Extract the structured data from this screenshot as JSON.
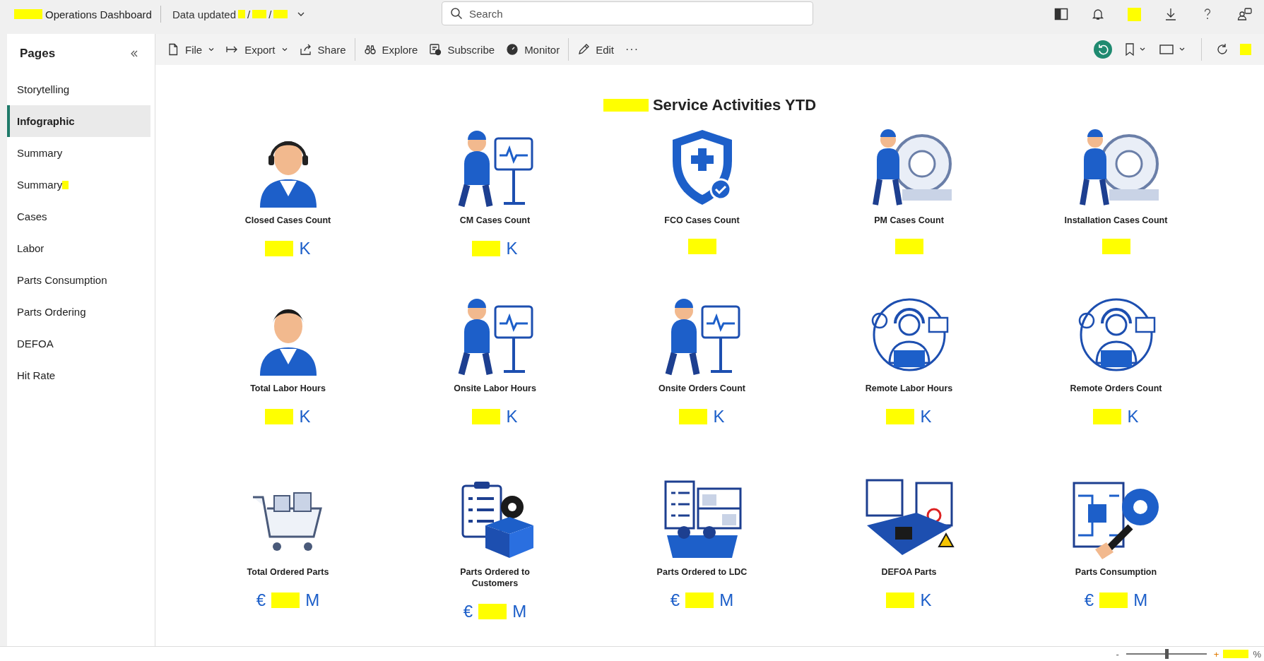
{
  "app_bar": {
    "title": "Operations Dashboard",
    "title_redacted": true,
    "data_updated": "Data updated",
    "date_separators": [
      "/",
      "/"
    ],
    "search": {
      "placeholder": "Search"
    }
  },
  "toolbar": {
    "buttons": [
      {
        "label": "File",
        "has_menu": true,
        "separator_after": false
      },
      {
        "label": "Export",
        "has_menu": true,
        "separator_after": false
      },
      {
        "label": "Share",
        "has_menu": false,
        "separator_after": true
      },
      {
        "label": "Explore",
        "has_menu": false,
        "separator_after": false
      },
      {
        "label": "Subscribe",
        "has_menu": false,
        "separator_after": false
      },
      {
        "label": "Monitor",
        "has_menu": false,
        "separator_after": true
      },
      {
        "label": "Edit",
        "has_menu": false,
        "separator_after": false
      }
    ],
    "more": "···"
  },
  "sidebar": {
    "title": "Pages",
    "items": [
      {
        "label": "Storytelling",
        "selected": false,
        "redacted": false
      },
      {
        "label": "Infographic",
        "selected": true,
        "redacted": false
      },
      {
        "label": "Summary",
        "selected": false,
        "redacted": false
      },
      {
        "label": "Summary",
        "selected": false,
        "redacted": true
      },
      {
        "label": "Cases",
        "selected": false,
        "redacted": false
      },
      {
        "label": "Labor",
        "selected": false,
        "redacted": false
      },
      {
        "label": "Parts Consumption",
        "selected": false,
        "redacted": false
      },
      {
        "label": "Parts Ordering",
        "selected": false,
        "redacted": false
      },
      {
        "label": "DEFOA",
        "selected": false,
        "redacted": false
      },
      {
        "label": "Hit Rate",
        "selected": false,
        "redacted": false
      }
    ]
  },
  "report": {
    "title": "Service Activities YTD",
    "title_redacted": true,
    "cards": [
      {
        "label": "Closed Cases Count",
        "redacted": true,
        "suffix": "K"
      },
      {
        "label": "CM Cases Count",
        "redacted": true,
        "suffix": "K"
      },
      {
        "label": "FCO Cases Count",
        "redacted": true
      },
      {
        "label": "PM Cases Count",
        "redacted": true
      },
      {
        "label": "Installation Cases Count",
        "redacted": true
      },
      {
        "label": "Total Labor Hours",
        "redacted": true,
        "suffix": "K"
      },
      {
        "label": "Onsite Labor Hours",
        "redacted": true,
        "suffix": "K"
      },
      {
        "label": "Onsite Orders Count",
        "redacted": true,
        "suffix": "K"
      },
      {
        "label": "Remote Labor Hours",
        "redacted": true,
        "suffix": "K"
      },
      {
        "label": "Remote Orders Count",
        "redacted": true,
        "suffix": "K"
      },
      {
        "label": "Total Ordered Parts",
        "prefix": "€",
        "redacted": true,
        "suffix": "M"
      },
      {
        "label": "Parts Ordered to Customers",
        "prefix": "€",
        "redacted": true,
        "suffix": "M"
      },
      {
        "label": "Parts Ordered to LDC",
        "prefix": "€",
        "redacted": true,
        "suffix": "M"
      },
      {
        "label": "DEFOA Parts",
        "redacted": true,
        "suffix": "K"
      },
      {
        "label": "Parts Consumption",
        "prefix": "€",
        "redacted": true,
        "suffix": "M"
      }
    ]
  },
  "status_bar": {
    "zoom": {
      "minus": "-",
      "plus": "+",
      "level": 0.5,
      "reading": "%",
      "reading_redacted": true
    }
  }
}
